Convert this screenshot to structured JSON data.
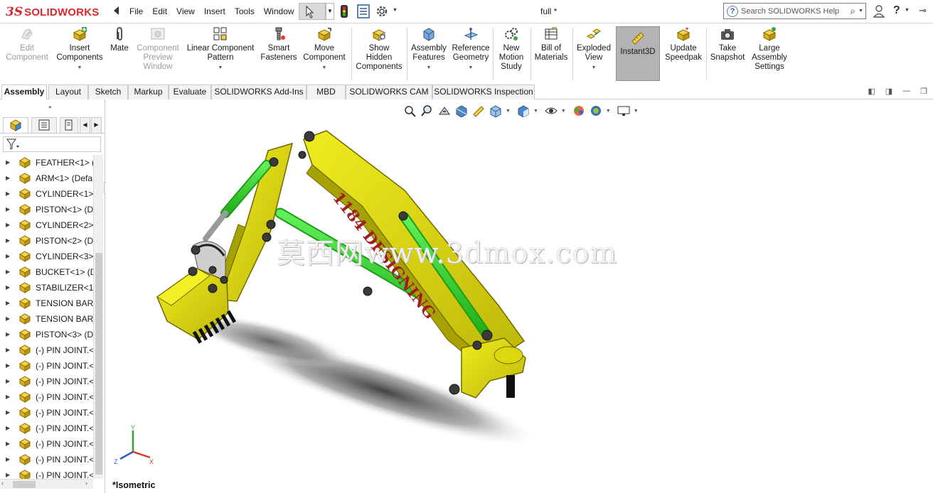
{
  "app": {
    "logo_prefix": "3S",
    "logo_name": "SOLIDWORKS",
    "doc_title": "full *",
    "menu": [
      "File",
      "Edit",
      "View",
      "Insert",
      "Tools",
      "Window"
    ],
    "search_placeholder": "Search SOLIDWORKS Help"
  },
  "toolbar_icons": [
    "back-arrow-icon",
    "select-icon",
    "traffic-light-icon",
    "document-properties-icon",
    "gear-icon",
    "user-icon",
    "help-icon",
    "pin-icon"
  ],
  "commands": [
    {
      "line1": "Edit",
      "line2": "Component",
      "line3": "",
      "enabled": false
    },
    {
      "line1": "Insert",
      "line2": "Components",
      "line3": "",
      "enabled": true
    },
    {
      "line1": "Mate",
      "line2": "",
      "line3": "",
      "enabled": true
    },
    {
      "line1": "Component",
      "line2": "Preview",
      "line3": "Window",
      "enabled": false
    },
    {
      "line1": "Linear Component",
      "line2": "Pattern",
      "line3": "",
      "enabled": true
    },
    {
      "line1": "Smart",
      "line2": "Fasteners",
      "line3": "",
      "enabled": true
    },
    {
      "line1": "Move",
      "line2": "Component",
      "line3": "",
      "enabled": true
    },
    {
      "line1": "Show",
      "line2": "Hidden",
      "line3": "Components",
      "enabled": true
    },
    {
      "line1": "Assembly",
      "line2": "Features",
      "line3": "",
      "enabled": true
    },
    {
      "line1": "Reference",
      "line2": "Geometry",
      "line3": "",
      "enabled": true
    },
    {
      "line1": "New",
      "line2": "Motion",
      "line3": "Study",
      "enabled": true
    },
    {
      "line1": "Bill of",
      "line2": "Materials",
      "line3": "",
      "enabled": true
    },
    {
      "line1": "Exploded",
      "line2": "View",
      "line3": "",
      "enabled": true
    },
    {
      "line1": "Instant3D",
      "line2": "",
      "line3": "",
      "enabled": true,
      "active": true
    },
    {
      "line1": "Update",
      "line2": "Speedpak",
      "line3": "",
      "enabled": true
    },
    {
      "line1": "Take",
      "line2": "Snapshot",
      "line3": "",
      "enabled": true
    },
    {
      "line1": "Large",
      "line2": "Assembly",
      "line3": "Settings",
      "enabled": true
    }
  ],
  "tabs": [
    "Assembly",
    "Layout",
    "Sketch",
    "Markup",
    "Evaluate",
    "SOLIDWORKS Add-Ins",
    "MBD",
    "SOLIDWORKS CAM",
    "SOLIDWORKS Inspection"
  ],
  "active_tab": "Assembly",
  "tree": [
    "FEATHER<1> (I",
    "ARM<1> (Defa",
    "CYLINDER<1>",
    "PISTON<1> (De",
    "CYLINDER<2>",
    "PISTON<2> (De",
    "CYLINDER<3>",
    "BUCKET<1> (D",
    "STABILIZER<1>",
    "TENSION BAR<",
    "TENSION BAR<",
    "PISTON<3> (De",
    "(-) PIN JOINT.<",
    "(-) PIN JOINT.<",
    "(-) PIN JOINT.<",
    "(-) PIN JOINT.<",
    "(-) PIN JOINT.<",
    "(-) PIN JOINT.<",
    "(-) PIN JOINT.<",
    "(-) PIN JOINT.<",
    "(-) PIN JOINT.<"
  ],
  "model": {
    "part_text": "1184 DESIGNING",
    "body_color": "#e3de10",
    "piston_color": "#35d329",
    "text_color": "#a01e1e"
  },
  "watermark": "莫西网www.3dmox.com",
  "triad": {
    "x": "X",
    "y": "Y",
    "z": "Z"
  },
  "view_label": "*Isometric"
}
